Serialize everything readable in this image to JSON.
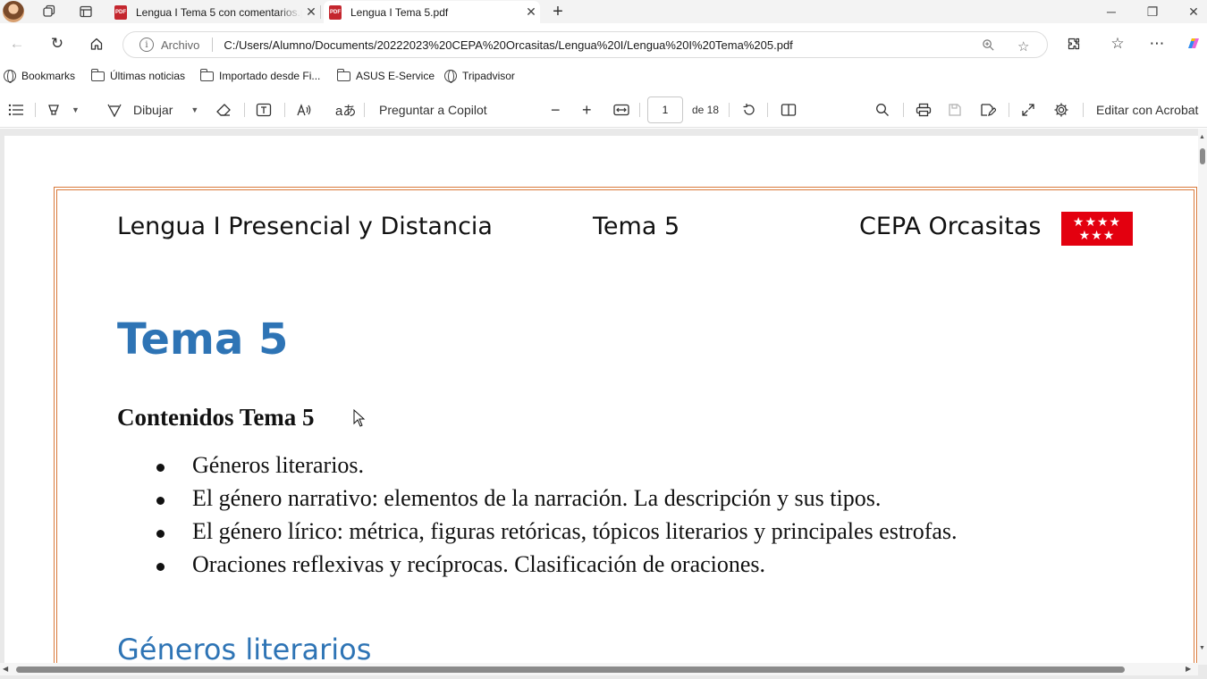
{
  "tabs": [
    {
      "label": "Lengua I Tema 5 con comentarios.pdf",
      "active": false
    },
    {
      "label": "Lengua I Tema 5.pdf",
      "active": true
    }
  ],
  "address": {
    "scheme_label": "Archivo",
    "url": "C:/Users/Alumno/Documents/20222023%20CEPA%20Orcasitas/Lengua%20I/Lengua%20I%20Tema%205.pdf"
  },
  "bookmarks": [
    {
      "label": "Bookmarks",
      "icon": "globe-icon"
    },
    {
      "label": "Últimas noticias",
      "icon": "folder-icon"
    },
    {
      "label": "Importado desde Fi...",
      "icon": "folder-icon"
    },
    {
      "label": "ASUS E-Service",
      "icon": "folder-icon"
    },
    {
      "label": "Tripadvisor",
      "icon": "globe-icon"
    }
  ],
  "pdf_toolbar": {
    "draw_label": "Dibujar",
    "copilot_label": "Preguntar a Copilot",
    "page_number": "1",
    "page_total": "de 18",
    "acrobat_label": "Editar con Acrobat"
  },
  "document": {
    "header_left": "Lengua I Presencial y Distancia",
    "header_center": "Tema 5",
    "header_right": "CEPA Orcasitas",
    "flag_stars": "★★★★\n★★★",
    "title": "Tema 5",
    "contents_heading": "Contenidos Tema 5",
    "contents": [
      "Géneros literarios.",
      "El género narrativo: elementos de la narración. La descripción y sus tipos.",
      "El género lírico: métrica, figuras retóricas, tópicos literarios y principales estrofas.",
      "Oraciones reflexivas y recíprocas. Clasificación de oraciones."
    ],
    "section_heading": "Géneros literarios"
  },
  "colors": {
    "heading_blue": "#2e74b5",
    "frame_orange": "#d9793a",
    "flag_red": "#e3000f",
    "pdf_icon_red": "#c4262e"
  }
}
